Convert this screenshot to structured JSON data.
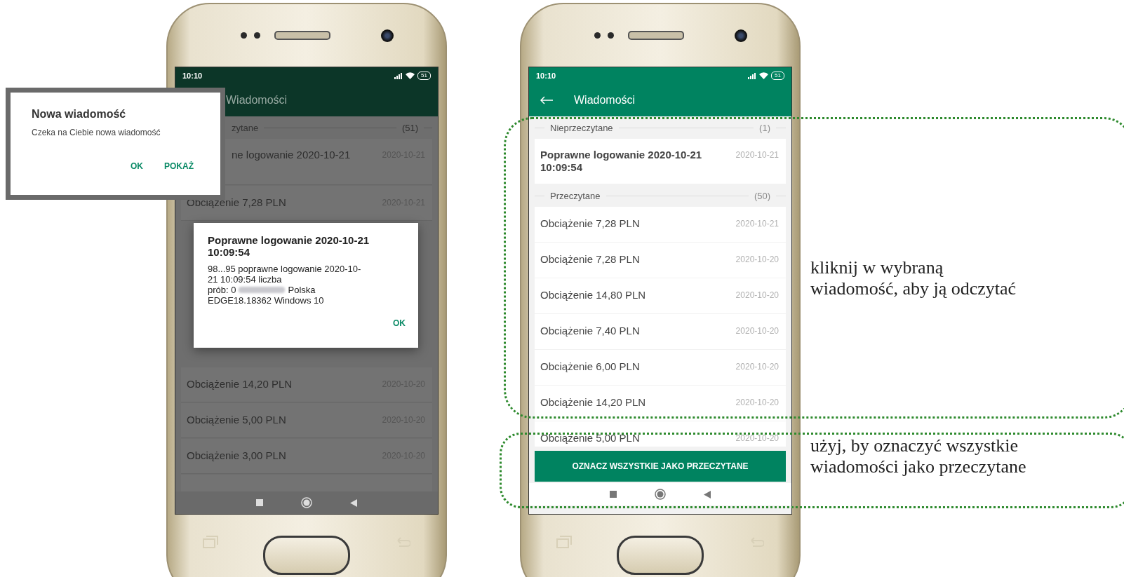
{
  "notification_popup": {
    "title": "Nowa wiadomość",
    "body": "Czeka na Ciebie nowa wiadomość",
    "buttons": [
      "OK",
      "POKAŻ"
    ]
  },
  "left_screen": {
    "time": "10:10",
    "battery": "51",
    "app_bar_title": "Wiadomości",
    "section": {
      "label": "zytane",
      "count": "(51)"
    },
    "rows_top": [
      {
        "title": "ne logowanie 2020-10-21",
        "date": "2020-10-21"
      },
      {
        "title": "Obciążenie 7,28 PLN",
        "date": "2020-10-21"
      }
    ],
    "dialog": {
      "title": "Poprawne logowanie 2020-10-21 10:09:54",
      "body_lines_start": "98...95 poprawne logowanie 2020-10-21 10:09:54 liczba",
      "before_blur": "prób: 0",
      "after_blur": "Polska",
      "body_end": "EDGE18.18362 Windows 10",
      "button": "OK"
    },
    "rows_bottom": [
      {
        "title": "Obciążenie 14,20 PLN",
        "date": "2020-10-20"
      },
      {
        "title": "Obciążenie 5,00 PLN",
        "date": "2020-10-20"
      },
      {
        "title": "Obciążenie 3,00 PLN",
        "date": "2020-10-20"
      }
    ]
  },
  "right_screen": {
    "time": "10:10",
    "battery": "51",
    "app_bar_title": "Wiadomości",
    "sections": [
      {
        "label": "Nieprzeczytane",
        "count": "(1)",
        "rows": [
          {
            "title": "Poprawne logowanie 2020-10-21 10:09:54",
            "date": "2020-10-21",
            "unread": true
          }
        ]
      },
      {
        "label": "Przeczytane",
        "count": "(50)",
        "rows": [
          {
            "title": "Obciążenie 7,28 PLN",
            "date": "2020-10-21",
            "unread": false
          },
          {
            "title": "Obciążenie 7,28 PLN",
            "date": "2020-10-20",
            "unread": false
          },
          {
            "title": "Obciążenie 14,80 PLN",
            "date": "2020-10-20",
            "unread": false
          },
          {
            "title": "Obciążenie 7,40 PLN",
            "date": "2020-10-20",
            "unread": false
          },
          {
            "title": "Obciążenie 6,00 PLN",
            "date": "2020-10-20",
            "unread": false
          },
          {
            "title": "Obciążenie 14,20 PLN",
            "date": "2020-10-20",
            "unread": false
          },
          {
            "title": "Obciążenie 5,00 PLN",
            "date": "2020-10-20",
            "unread": false
          }
        ]
      }
    ],
    "mark_all_button": "OZNACZ WSZYSTKIE JAKO PRZECZYTANE"
  },
  "annotations": [
    "kliknij w wybraną\nwiadomość, aby ją odczytać",
    "użyj, by oznaczyć wszystkie\nwiadomości jako przeczytane"
  ]
}
